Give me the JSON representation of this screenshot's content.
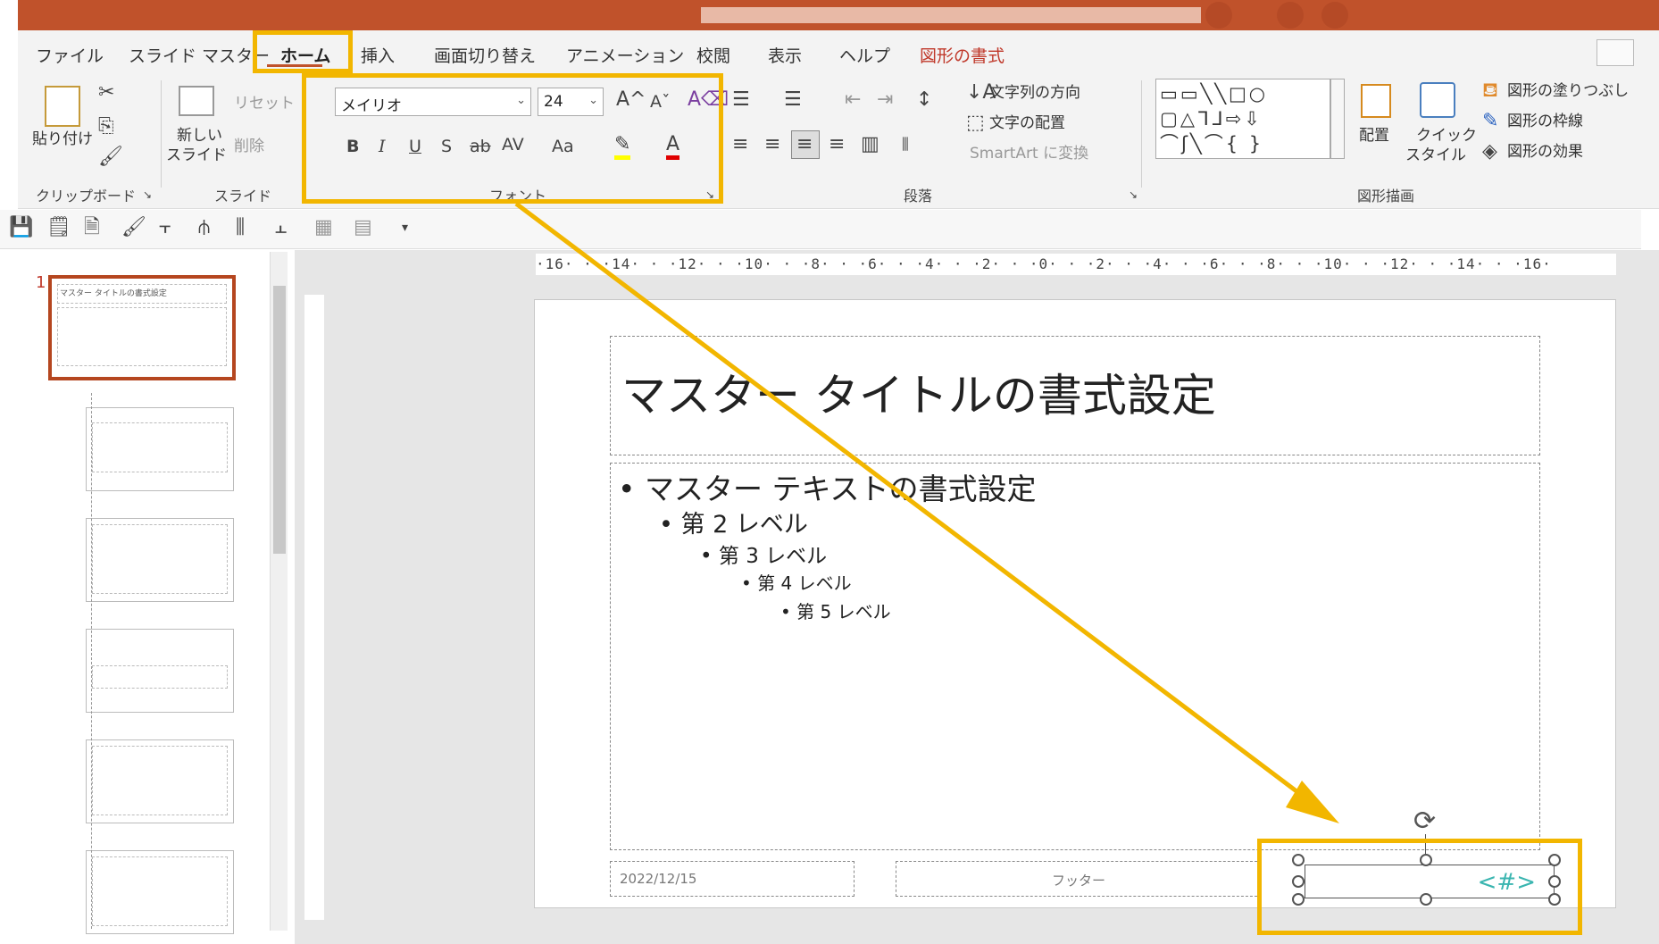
{
  "ribbon": {
    "tabs": [
      "ファイル",
      "スライド マスター",
      "ホーム",
      "挿入",
      "画面切り替え",
      "アニメーション",
      "校閲",
      "表示",
      "ヘルプ",
      "図形の書式"
    ],
    "clipboard": {
      "paste": "貼り付け",
      "group": "クリップボード"
    },
    "slides": {
      "new_slide_1": "新しい",
      "new_slide_2": "スライド",
      "reset": "リセット",
      "delete": "削除",
      "group": "スライド"
    },
    "font": {
      "name": "メイリオ",
      "size": "24",
      "group": "フォント",
      "bold": "B",
      "italic": "I",
      "underline": "U",
      "shadow": "S",
      "strike": "ab",
      "spacing": "AV",
      "case": "Aa"
    },
    "paragraph": {
      "text_direction": "文字列の方向",
      "text_align": "文字の配置",
      "smartart": "SmartArt に変換",
      "group": "段落"
    },
    "drawing": {
      "arrange": "配置",
      "quick_styles_1": "クイック",
      "quick_styles_2": "スタイル",
      "fill": "図形の塗りつぶし",
      "outline": "図形の枠線",
      "effects": "図形の効果",
      "group": "図形描画"
    }
  },
  "thumbs": {
    "slide_number": "1",
    "master_title": "マスター タイトルの書式設定"
  },
  "ruler": {
    "horizontal": "·16· · ·14· · ·12· · ·10· · ·8· · ·6· · ·4· · ·2· · ·0· · ·2· · ·4· · ·6· · ·8· · ·10· · ·12· · ·14· · ·16·"
  },
  "slide": {
    "title": "マスター タイトルの書式設定",
    "level1": "• マスター テキストの書式設定",
    "level2": "• 第 2 レベル",
    "level3": "• 第 3 レベル",
    "level4": "• 第 4 レベル",
    "level5": "• 第 5 レベル",
    "date": "2022/12/15",
    "footer": "フッター",
    "page_number": "<#>"
  },
  "colors": {
    "accent": "#c0522b",
    "highlight": "#f2b600",
    "page_number": "#3ab5b0"
  }
}
